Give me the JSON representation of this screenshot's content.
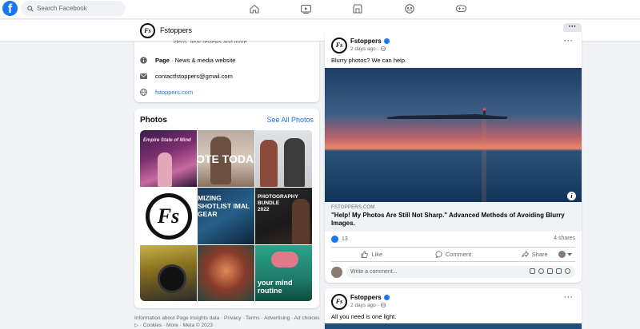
{
  "topbar": {
    "logo_letter": "f",
    "search_placeholder": "Search Facebook",
    "nav_icons": [
      "home-icon",
      "video-icon",
      "marketplace-icon",
      "groups-icon",
      "gaming-icon"
    ]
  },
  "pagebar": {
    "name": "Fstoppers",
    "more_label": "···"
  },
  "intro": {
    "cut_text": "...ideos, gear reviews and more",
    "category_bold": "Page",
    "category_rest": " · News & media website",
    "email": "contactfstoppers@gmail.com",
    "website": "fstoppers.com"
  },
  "photos": {
    "title": "Photos",
    "see_all": "See All Photos",
    "tiles": [
      {
        "caption": "Empire State of Mind"
      },
      {
        "caption": "OTE TODA"
      },
      {
        "caption": ""
      },
      {
        "caption": "Fs"
      },
      {
        "caption": "MIZING SHOTLIST IMAL GEAR"
      },
      {
        "caption": "PHOTOGRAPHY BUNDLE 2022"
      },
      {
        "caption": ""
      },
      {
        "caption": ""
      },
      {
        "caption": "your mind routine"
      }
    ]
  },
  "footer": "Information about Page Insights data · Privacy · Terms · Advertising · Ad choices ▷ · Cookies · More · Meta © 2023",
  "post1": {
    "author": "Fstoppers",
    "time": "2 days ago · ",
    "text": "Blurry photos? We can help.",
    "link_domain": "FSTOPPERS.COM",
    "link_title": "\"Help! My Photos Are Still Not Sharp.\" Advanced Methods of Avoiding Blurry Images.",
    "reaction_count": "13",
    "shares": "4 shares",
    "like_label": "Like",
    "comment_label": "Comment",
    "share_label": "Share",
    "comment_placeholder": "Write a comment..."
  },
  "post2": {
    "author": "Fstoppers",
    "time": "2 days ago · ",
    "text": "All you need is one light."
  },
  "colors": {
    "brand": "#1877f2",
    "link": "#216fdb",
    "background": "#f0f2f5"
  }
}
